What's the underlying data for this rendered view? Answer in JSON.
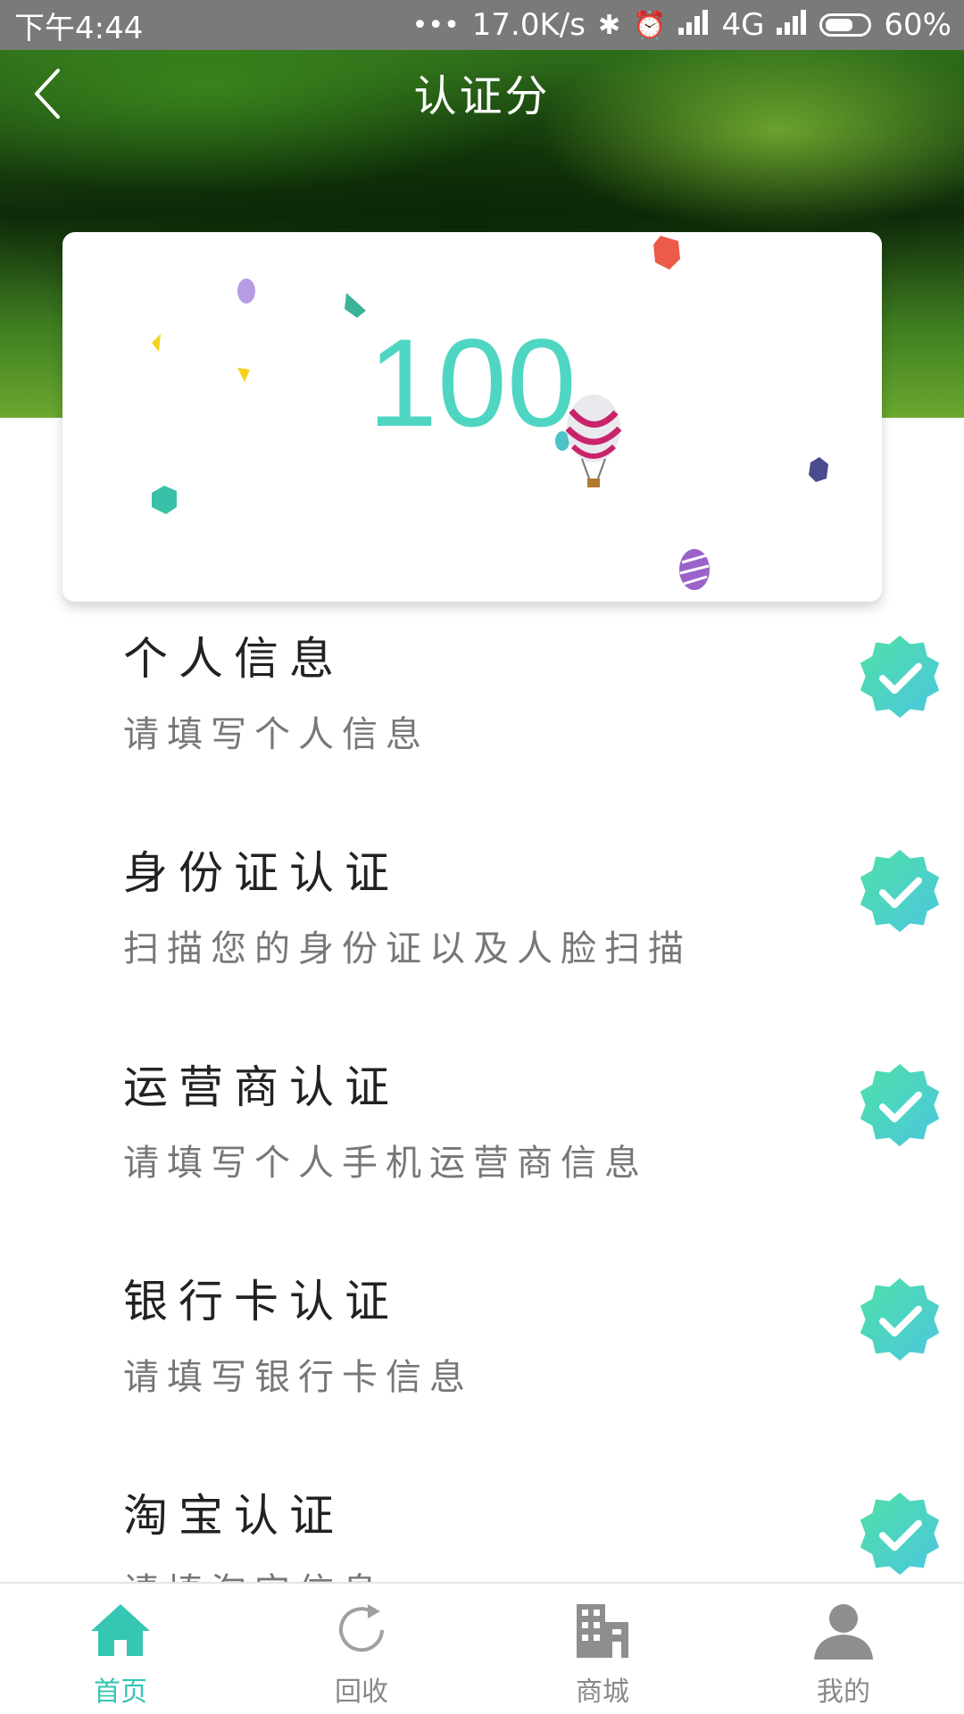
{
  "status_bar": {
    "time": "下午4:44",
    "dots": "•••",
    "net_speed": "17.0K/s",
    "network": "4G",
    "battery": "60%"
  },
  "header": {
    "title": "认证分",
    "back_icon": "chevron-left-icon"
  },
  "score": {
    "value": "100"
  },
  "certifications": [
    {
      "title": "个人信息",
      "desc": "请填写个人信息",
      "status_icon": "verified-check-icon"
    },
    {
      "title": "身份证认证",
      "desc": "扫描您的身份证以及人脸扫描",
      "status_icon": "verified-check-icon"
    },
    {
      "title": "运营商认证",
      "desc": "请填写个人手机运营商信息",
      "status_icon": "verified-check-icon"
    },
    {
      "title": "银行卡认证",
      "desc": "请填写银行卡信息",
      "status_icon": "verified-check-icon"
    },
    {
      "title": "淘宝认证",
      "desc": "请填淘宝信息",
      "status_icon": "verified-check-icon"
    }
  ],
  "bottom_nav": [
    {
      "label": "首页",
      "icon": "home-icon",
      "active": true
    },
    {
      "label": "回收",
      "icon": "refresh-icon",
      "active": false
    },
    {
      "label": "商城",
      "icon": "building-icon",
      "active": false
    },
    {
      "label": "我的",
      "icon": "user-icon",
      "active": false
    }
  ],
  "colors": {
    "accent": "#35c6b4",
    "score": "#4fd6c2",
    "badge_start": "#4ee0a6",
    "badge_end": "#4cc7df"
  }
}
